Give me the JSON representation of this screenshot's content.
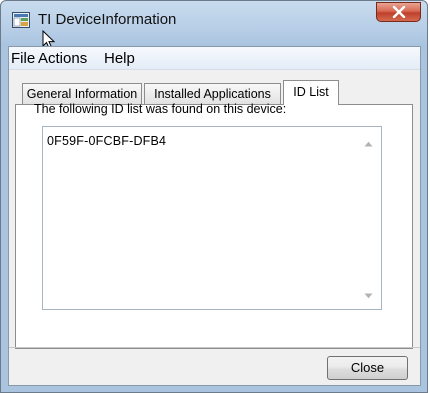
{
  "window": {
    "title": "TI DeviceInformation",
    "close_glyph": "X"
  },
  "menu": {
    "items": [
      "File",
      "Actions",
      "Help"
    ]
  },
  "tabs": [
    {
      "label": "General Information",
      "active": false
    },
    {
      "label": "Installed Applications",
      "active": false
    },
    {
      "label": "ID List",
      "active": true
    }
  ],
  "panel": {
    "description": "The following ID list was found on this device:",
    "id_values": [
      "0F59F-0FCBF-DFB4"
    ]
  },
  "footer": {
    "close_label": "Close"
  },
  "icons": {
    "app": "app-icon",
    "cursor": "mouse-cursor-icon",
    "window_close": "close-icon",
    "scroll_up": "scroll-up-arrow-icon",
    "scroll_down": "scroll-down-arrow-icon"
  },
  "colors": {
    "titlebar": "#b6cde6",
    "close_button": "#c1402a",
    "panel_background": "#ffffff"
  }
}
